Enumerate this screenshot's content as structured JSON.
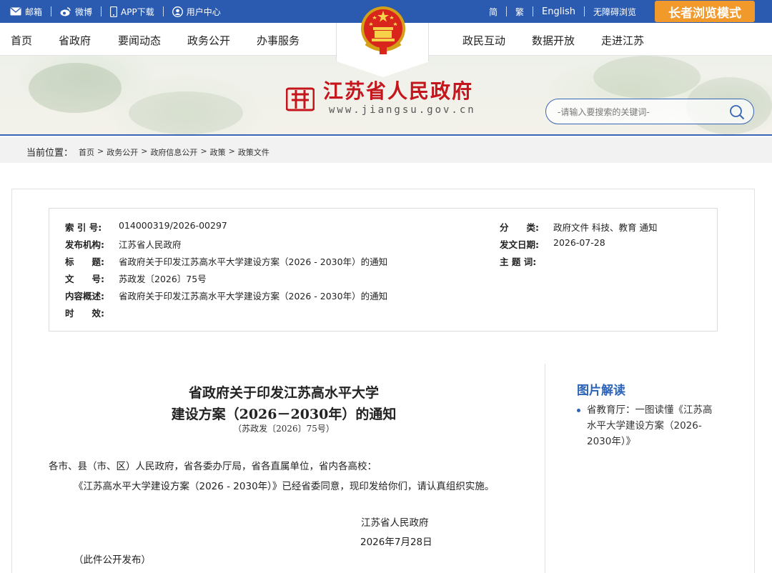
{
  "topbar": {
    "mail": "邮箱",
    "weibo": "微博",
    "app": "APP下载",
    "user": "用户中心",
    "simplified": "简",
    "traditional": "繁",
    "english": "English",
    "accessible": "无障碍浏览",
    "elder_mode": "长者浏览模式"
  },
  "nav": {
    "items": [
      "首页",
      "省政府",
      "要闻动态",
      "政务公开",
      "办事服务",
      "政民互动",
      "数据开放",
      "走进江苏"
    ]
  },
  "banner": {
    "title": "江苏省人民政府",
    "url": "www.jiangsu.gov.cn",
    "search_placeholder": "-请输入要搜索的关键词-"
  },
  "breadcrumb": {
    "label": "当前位置：",
    "items": [
      "首页",
      "政务公开",
      "政府信息公开",
      "政策",
      "政策文件"
    ],
    "separator": ">"
  },
  "meta": {
    "index_label": "索 引 号:",
    "index_value": "014000319/2026-00297",
    "org_label": "发布机构:",
    "org_value": "江苏省人民政府",
    "title_label": "标　　题:",
    "title_value": "省政府关于印发江苏高水平大学建设方案（2026 - 2030年）的通知",
    "docno_label": "文　　号:",
    "docno_value": "苏政发〔2026〕75号",
    "summary_label": "内容概述:",
    "summary_value": "省政府关于印发江苏高水平大学建设方案（2026 - 2030年）的通知",
    "validity_label": "时　　效:",
    "validity_value": "",
    "category_label": "分　　类:",
    "category_value": "政府文件 科技、教育 通知",
    "date_label": "发文日期:",
    "date_value": "2026-07-28",
    "keywords_label": "主 题 词:",
    "keywords_value": ""
  },
  "document": {
    "title_line1": "省政府关于印发江苏高水平大学",
    "title_line2": "建设方案（2026－2030年）的通知",
    "number": "（苏政发〔2026〕75号）",
    "addressee": "各市、县（市、区）人民政府，省各委办厅局，省各直属单位，省内各高校：",
    "body": "《江苏高水平大学建设方案（2026 - 2030年）》已经省委同意，现印发给你们，请认真组织实施。",
    "signer": "江苏省人民政府",
    "sign_date": "2026年7月28日",
    "note": "（此件公开发布）"
  },
  "sidebar": {
    "title": "图片解读",
    "item": "省教育厅：一图读懂《江苏高水平大学建设方案（2026-2030年）》"
  },
  "colors": {
    "topbar": "#2b5bb0",
    "elder_button": "#f19a2b",
    "title_red": "#c4161c",
    "link_blue": "#2a63b8"
  }
}
